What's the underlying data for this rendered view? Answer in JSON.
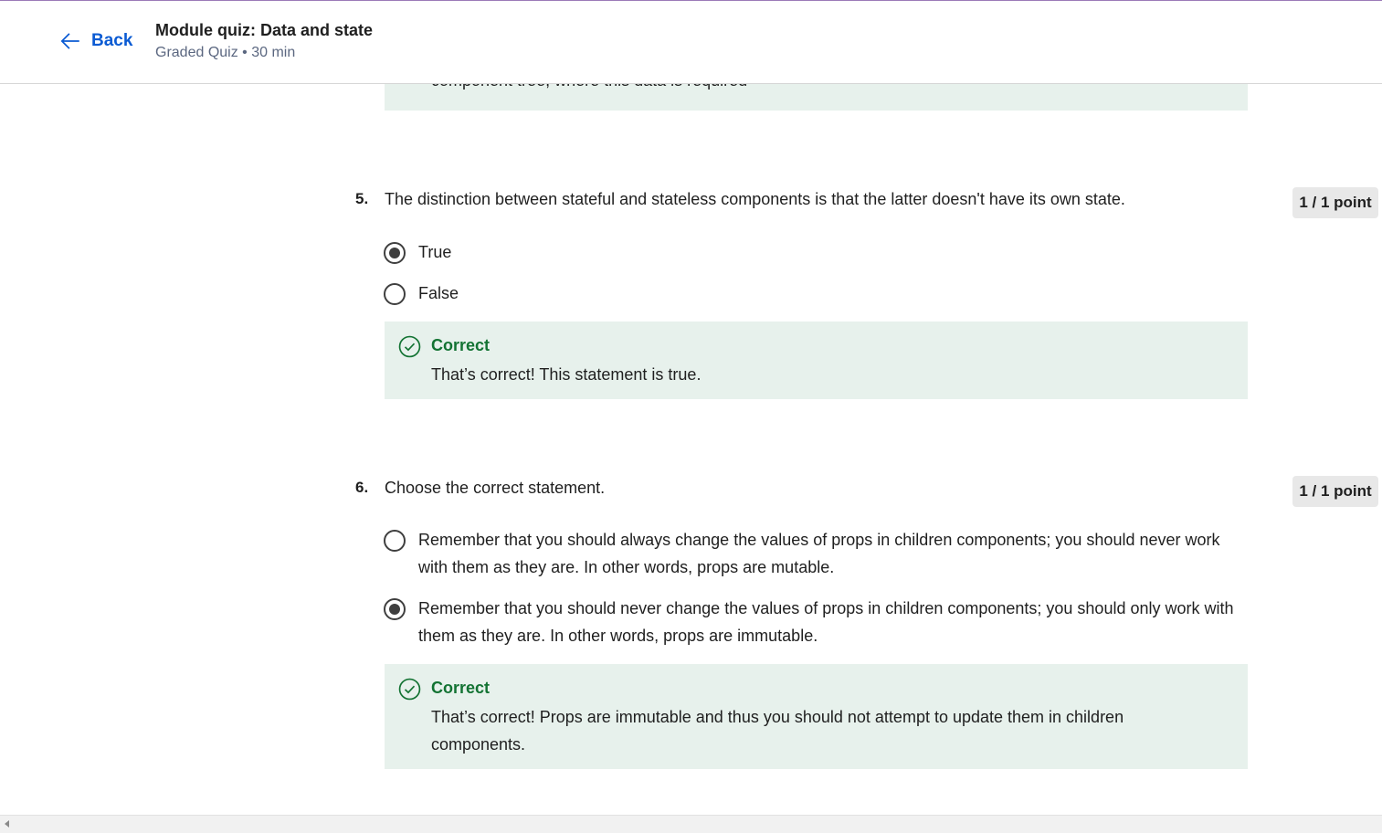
{
  "header": {
    "back_label": "Back",
    "title": "Module quiz: Data and state",
    "subtitle": "Graded Quiz • 30 min"
  },
  "partial_feedback_text": "component tree, where this data is required",
  "questions": [
    {
      "number": "5.",
      "text": "The distinction between stateful and stateless components is that the latter doesn't have its own state.",
      "points": "1 / 1 point",
      "options": [
        {
          "label": "True",
          "selected": true
        },
        {
          "label": "False",
          "selected": false
        }
      ],
      "feedback": {
        "title": "Correct",
        "text": "That’s correct! This statement is true."
      }
    },
    {
      "number": "6.",
      "text": "Choose the correct statement.",
      "points": "1 / 1 point",
      "options": [
        {
          "label": "Remember that you should always change the values of props in children components; you should never work with them as they are. In other words, props are mutable.",
          "selected": false
        },
        {
          "label": "Remember that you should never change the values of props in children components; you should only work with them as they are. In other words, props are immutable.",
          "selected": true
        }
      ],
      "feedback": {
        "title": "Correct",
        "text": "That’s correct! Props are immutable and thus you should not attempt to update them in children components."
      }
    }
  ],
  "icons": {
    "back": "arrow-left-icon",
    "correct": "check-circle-icon",
    "scroll_left": "scroll-left-arrow-icon"
  },
  "colors": {
    "accent": "#0b5bd3",
    "correct_green": "#137333",
    "feedback_bg": "#e7f1ec",
    "points_bg": "#e8e8e8"
  }
}
